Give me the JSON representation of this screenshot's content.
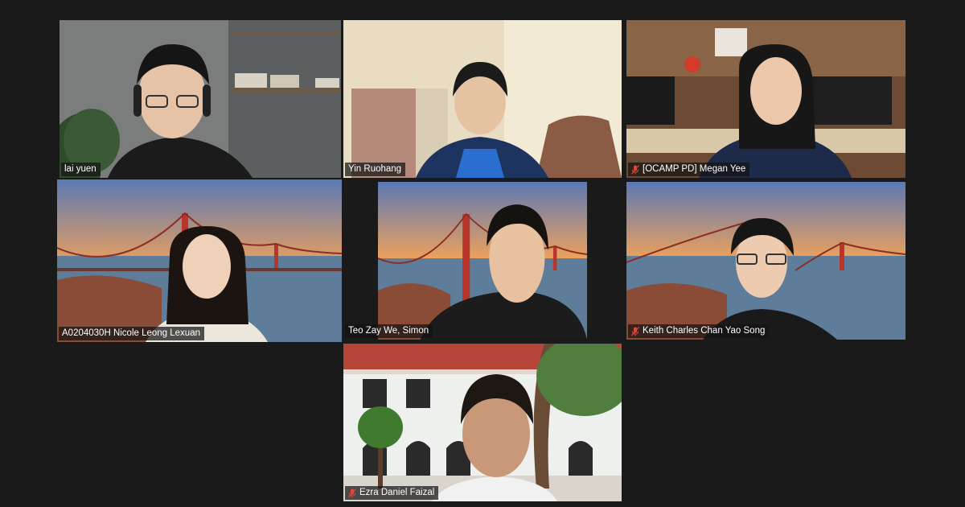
{
  "app": {
    "colors": {
      "background": "#1a1a1a",
      "active_speaker_border": "#c9e35b",
      "muted_red": "#e0463a"
    }
  },
  "participants": [
    {
      "name": "lai yuen",
      "muted": false,
      "active": false
    },
    {
      "name": "Yin Ruohang",
      "muted": false,
      "active": false
    },
    {
      "name": "[OCAMP PD] Megan Yee",
      "muted": true,
      "active": false
    },
    {
      "name": "A0204030H Nicole Leong Lexuan",
      "muted": false,
      "active": true
    },
    {
      "name": "Teo Zay We, Simon",
      "muted": false,
      "active": false
    },
    {
      "name": "Keith Charles Chan Yao Song",
      "muted": true,
      "active": false
    },
    {
      "name": "Ezra Daniel Faizal",
      "muted": true,
      "active": false
    }
  ]
}
